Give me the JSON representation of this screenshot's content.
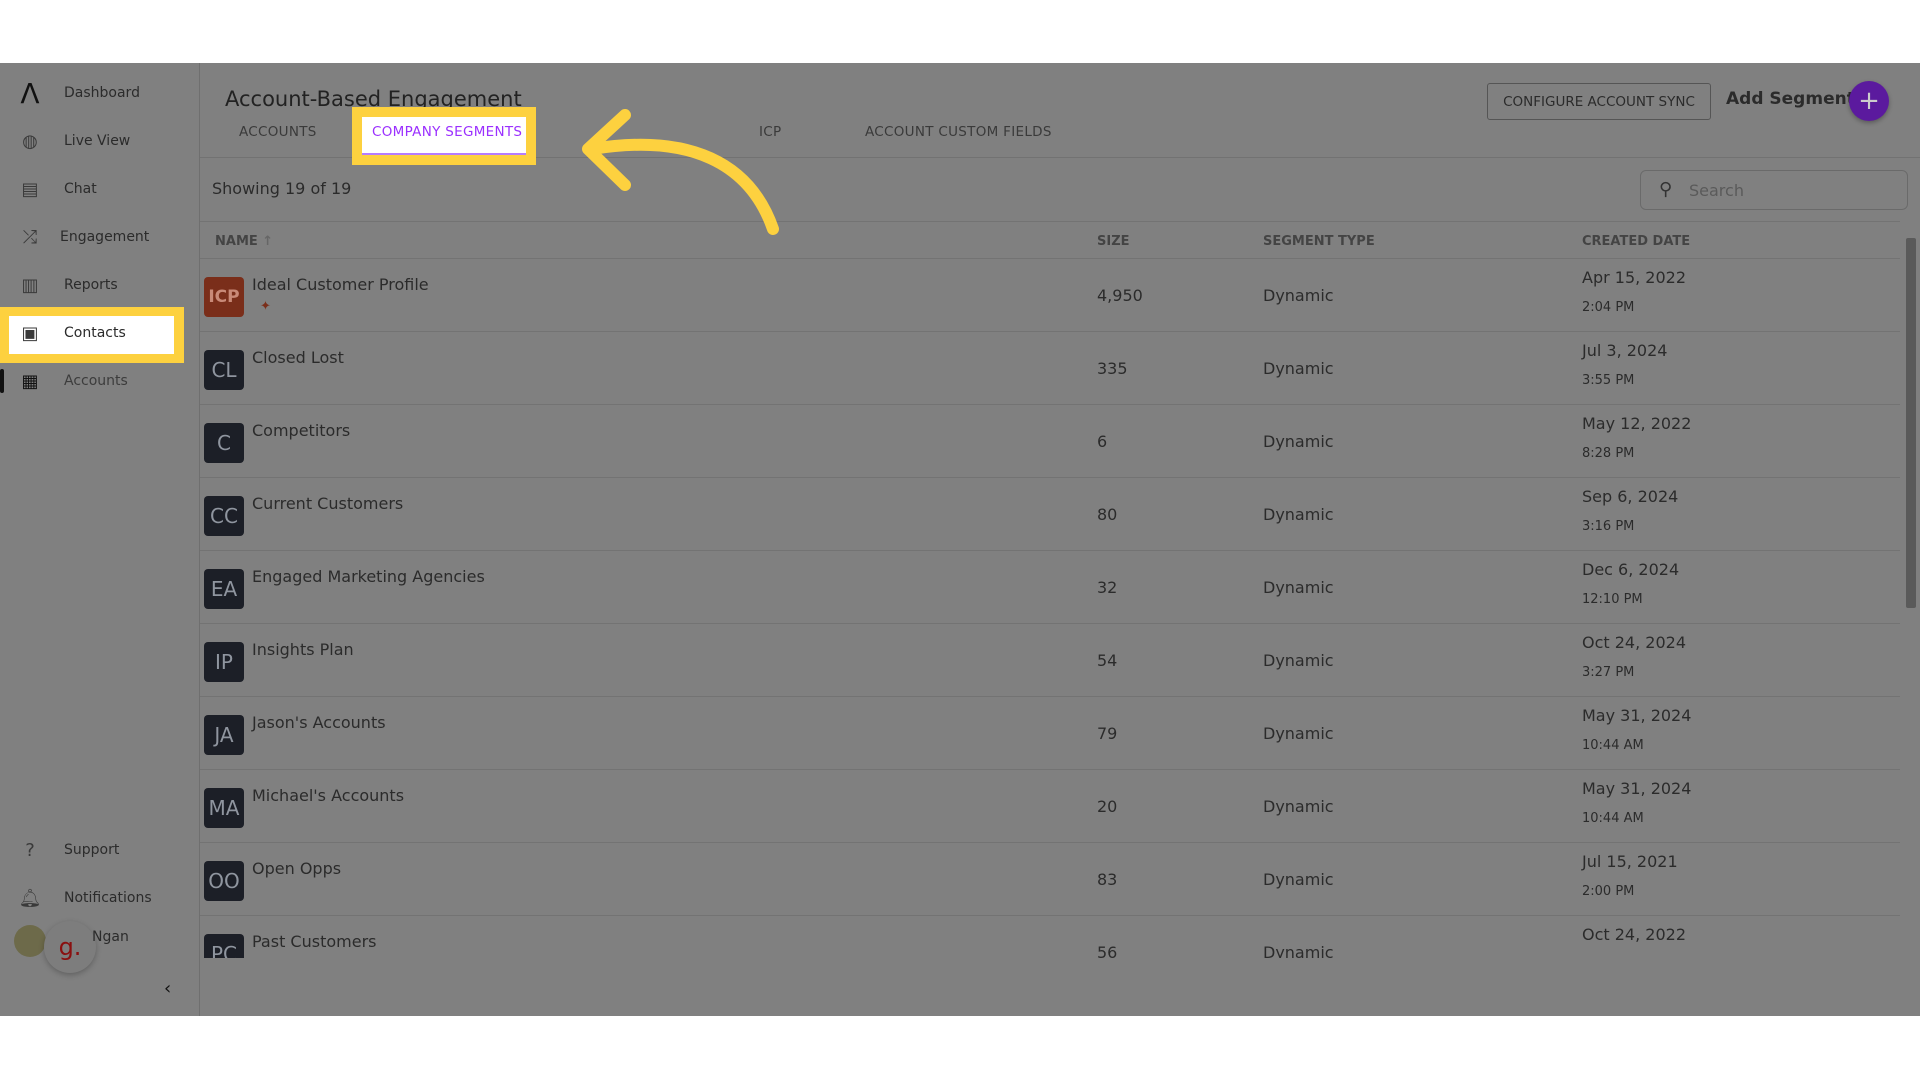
{
  "sidebar": {
    "items": [
      {
        "label": "Dashboard",
        "icon": "logo-icon"
      },
      {
        "label": "Live View",
        "icon": "live-view-icon"
      },
      {
        "label": "Chat",
        "icon": "chat-icon"
      },
      {
        "label": "Engagement",
        "icon": "engagement-icon"
      },
      {
        "label": "Reports",
        "icon": "bar-chart-icon"
      },
      {
        "label": "Contacts",
        "icon": "contacts-icon"
      },
      {
        "label": "Accounts",
        "icon": "building-icon"
      }
    ],
    "bottom": [
      {
        "label": "Support",
        "icon": "help-icon"
      },
      {
        "label": "Notifications",
        "icon": "bell-icon"
      }
    ],
    "user": {
      "name": "Ngan",
      "badge": "g."
    }
  },
  "header": {
    "title": "Account-Based Engagement",
    "configure_label": "CONFIGURE ACCOUNT SYNC",
    "add_label": "Add Segment",
    "add_icon": "+"
  },
  "tabs": [
    {
      "label": "ACCOUNTS"
    },
    {
      "label": "COMPANY SEGMENTS",
      "active": true
    },
    {
      "label": "ICP"
    },
    {
      "label": "ACCOUNT CUSTOM FIELDS"
    }
  ],
  "toolbar": {
    "showing": "Showing 19 of  19",
    "search_placeholder": "Search"
  },
  "table": {
    "columns": [
      "NAME",
      "SIZE",
      "SEGMENT TYPE",
      "CREATED DATE"
    ],
    "sort_icon": "↑",
    "rows": [
      {
        "initials": "ICP",
        "name": "Ideal Customer Profile",
        "size": "4,950",
        "type": "Dynamic",
        "date": "Apr 15, 2022",
        "time": "2:04 PM",
        "color": "#7a2e1a"
      },
      {
        "initials": "CL",
        "name": "Closed Lost",
        "size": "335",
        "type": "Dynamic",
        "date": "Jul 3, 2024",
        "time": "3:55 PM"
      },
      {
        "initials": "C",
        "name": "Competitors",
        "size": "6",
        "type": "Dynamic",
        "date": "May 12, 2022",
        "time": "8:28 PM"
      },
      {
        "initials": "CC",
        "name": "Current Customers",
        "size": "80",
        "type": "Dynamic",
        "date": "Sep 6, 2024",
        "time": "3:16 PM"
      },
      {
        "initials": "EA",
        "name": "Engaged Marketing Agencies",
        "size": "32",
        "type": "Dynamic",
        "date": "Dec 6, 2024",
        "time": "12:10 PM"
      },
      {
        "initials": "IP",
        "name": "Insights Plan",
        "size": "54",
        "type": "Dynamic",
        "date": "Oct 24, 2024",
        "time": "3:27 PM"
      },
      {
        "initials": "JA",
        "name": "Jason's Accounts",
        "size": "79",
        "type": "Dynamic",
        "date": "May 31, 2024",
        "time": "10:44 AM"
      },
      {
        "initials": "MA",
        "name": "Michael's Accounts",
        "size": "20",
        "type": "Dynamic",
        "date": "May 31, 2024",
        "time": "10:44 AM"
      },
      {
        "initials": "OO",
        "name": "Open Opps",
        "size": "83",
        "type": "Dynamic",
        "date": "Jul 15, 2021",
        "time": "2:00 PM"
      },
      {
        "initials": "PC",
        "name": "Past Customers",
        "size": "56",
        "type": "Dynamic",
        "date": "Oct 24, 2022",
        "time": ""
      }
    ]
  },
  "colors": {
    "accent": "#5b1a9e",
    "highlight": "#fdd13f",
    "active_tab": "#9b30ff"
  }
}
